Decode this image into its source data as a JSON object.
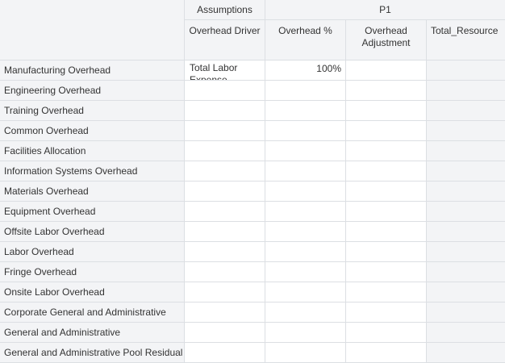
{
  "header": {
    "group_assumptions": "Assumptions",
    "group_period": "P1",
    "columns": [
      "Overhead Driver",
      "Overhead %",
      "Overhead Adjustment",
      "Total_Resource"
    ]
  },
  "rows": [
    {
      "label": "Manufacturing Overhead",
      "driver": "Total Labor Expense",
      "overhead_pct": "100%",
      "adjustment": "",
      "total_resource": ""
    },
    {
      "label": "Engineering Overhead",
      "driver": "",
      "overhead_pct": "",
      "adjustment": "",
      "total_resource": ""
    },
    {
      "label": "Training Overhead",
      "driver": "",
      "overhead_pct": "",
      "adjustment": "",
      "total_resource": ""
    },
    {
      "label": "Common Overhead",
      "driver": "",
      "overhead_pct": "",
      "adjustment": "",
      "total_resource": ""
    },
    {
      "label": "Facilities Allocation",
      "driver": "",
      "overhead_pct": "",
      "adjustment": "",
      "total_resource": ""
    },
    {
      "label": "Information Systems Overhead",
      "driver": "",
      "overhead_pct": "",
      "adjustment": "",
      "total_resource": ""
    },
    {
      "label": "Materials Overhead",
      "driver": "",
      "overhead_pct": "",
      "adjustment": "",
      "total_resource": ""
    },
    {
      "label": "Equipment Overhead",
      "driver": "",
      "overhead_pct": "",
      "adjustment": "",
      "total_resource": ""
    },
    {
      "label": "Offsite Labor Overhead",
      "driver": "",
      "overhead_pct": "",
      "adjustment": "",
      "total_resource": ""
    },
    {
      "label": "Labor Overhead",
      "driver": "",
      "overhead_pct": "",
      "adjustment": "",
      "total_resource": ""
    },
    {
      "label": "Fringe Overhead",
      "driver": "",
      "overhead_pct": "",
      "adjustment": "",
      "total_resource": ""
    },
    {
      "label": "Onsite Labor Overhead",
      "driver": "",
      "overhead_pct": "",
      "adjustment": "",
      "total_resource": ""
    },
    {
      "label": "Corporate General and Administrative",
      "driver": "",
      "overhead_pct": "",
      "adjustment": "",
      "total_resource": ""
    },
    {
      "label": "General and Administrative",
      "driver": "",
      "overhead_pct": "",
      "adjustment": "",
      "total_resource": ""
    },
    {
      "label": "General and Administrative Pool Residual",
      "driver": "",
      "overhead_pct": "",
      "adjustment": "",
      "total_resource": ""
    }
  ]
}
